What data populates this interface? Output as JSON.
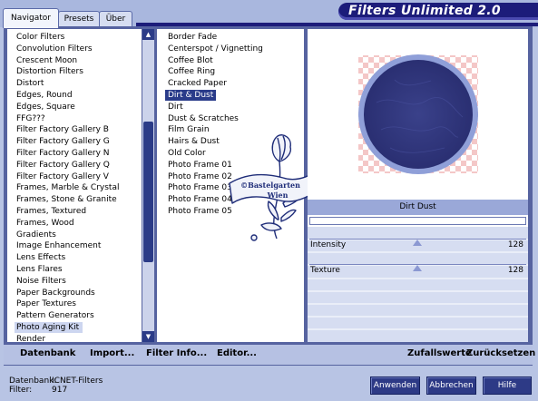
{
  "tabs": [
    "Navigator",
    "Presets",
    "Über"
  ],
  "app_title": "Filters Unlimited 2.0",
  "categories": [
    "Color Filters",
    "Convolution Filters",
    "Crescent Moon",
    "Distortion Filters",
    "Distort",
    "Edges, Round",
    "Edges, Square",
    "FFG???",
    "Filter Factory Gallery B",
    "Filter Factory Gallery G",
    "Filter Factory Gallery N",
    "Filter Factory Gallery Q",
    "Filter Factory Gallery V",
    "Frames, Marble & Crystal",
    "Frames, Stone & Granite",
    "Frames, Textured",
    "Frames, Wood",
    "Gradients",
    "Image Enhancement",
    "Lens Effects",
    "Lens Flares",
    "Noise Filters",
    "Paper Backgrounds",
    "Paper Textures",
    "Pattern Generators",
    "Photo Aging Kit",
    "Render"
  ],
  "selected_category_index": 25,
  "filters": [
    "Border Fade",
    "Centerspot / Vignetting",
    "Coffee Blot",
    "Coffee Ring",
    "Cracked Paper",
    "Dirt & Dust",
    "Dirt",
    "Dust & Scratches",
    "Film Grain",
    "Hairs & Dust",
    "Old Color",
    "Photo Frame 01",
    "Photo Frame 02",
    "Photo Frame 03",
    "Photo Frame 04",
    "Photo Frame 05"
  ],
  "selected_filter_index": 5,
  "watermark": [
    "©Bastelgarten",
    "Wien"
  ],
  "preview_label": "Dirt  Dust",
  "sliders": [
    {
      "label": "Intensity",
      "value": "128",
      "level": 0.5
    },
    {
      "label": "Texture",
      "value": "128",
      "level": 0.5
    }
  ],
  "action_buttons": [
    "Datenbank",
    "Import...",
    "Filter Info...",
    "Editor..."
  ],
  "right_buttons": [
    "Zufallswerte",
    "Zurücksetzen"
  ],
  "status": {
    "database_label": "Datenbank:",
    "database_value": "ICNET-Filters",
    "filter_label": "Filter:",
    "filter_value": "917"
  },
  "dialog_buttons": [
    "Anwenden",
    "Abbrechen",
    "Hilfe"
  ],
  "colors": {
    "navy": "#2b3b87",
    "brand": "#1c1c7a",
    "background": "#b8c4e4",
    "preview_circle": "#2d3478"
  }
}
